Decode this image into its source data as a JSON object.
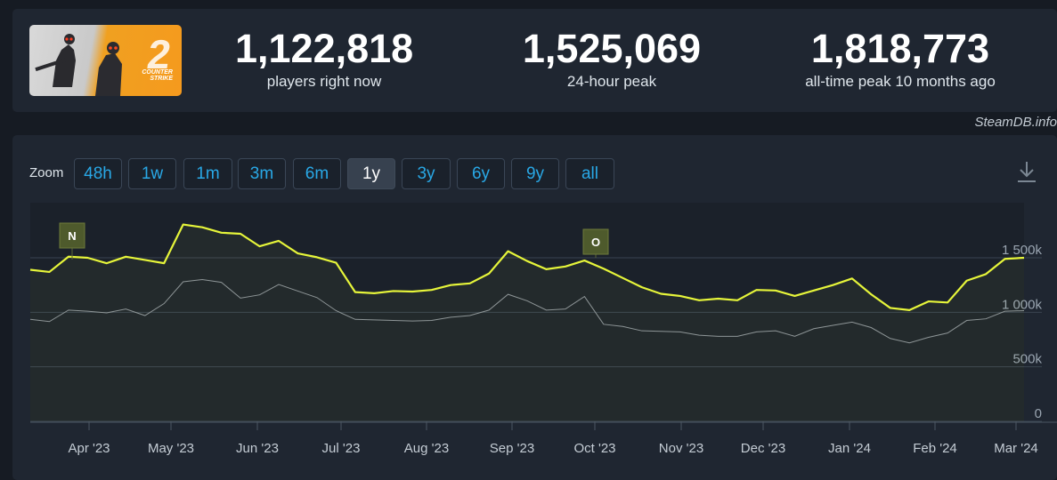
{
  "header": {
    "logo": {
      "icon": "counter-strike-2-logo",
      "text_line1": "COUNTER",
      "text_line2": "STRIKE",
      "num": "2"
    },
    "stats": [
      {
        "value": "1,122,818",
        "label": "players right now"
      },
      {
        "value": "1,525,069",
        "label": "24-hour peak"
      },
      {
        "value": "1,818,773",
        "label": "all-time peak 10 months ago"
      }
    ]
  },
  "watermark": "SteamDB.info",
  "toolbar": {
    "zoom_label": "Zoom",
    "zoom_buttons": [
      "48h",
      "1w",
      "1m",
      "3m",
      "6m",
      "1y",
      "3y",
      "6y",
      "9y",
      "all"
    ],
    "active_zoom": "1y",
    "download_icon": "download-icon"
  },
  "colors": {
    "primary_line": "#e6f53a",
    "secondary_line": "#8d949c",
    "flag_bg": "#4e5a2c",
    "accent_blue": "#29a8e6"
  },
  "chart_data": {
    "type": "line",
    "x": [
      "2023-03-06",
      "2023-03-11",
      "2023-03-13",
      "2023-03-21",
      "2023-03-29",
      "2023-04-06",
      "2023-04-14",
      "2023-04-22",
      "2023-04-30",
      "2023-05-07",
      "2023-05-15",
      "2023-05-22",
      "2023-05-30",
      "2023-06-06",
      "2023-06-14",
      "2023-06-21",
      "2023-06-29",
      "2023-07-06",
      "2023-07-14",
      "2023-07-21",
      "2023-07-29",
      "2023-08-05",
      "2023-08-13",
      "2023-08-20",
      "2023-08-27",
      "2023-09-02",
      "2023-09-10",
      "2023-09-17",
      "2023-09-25",
      "2023-10-02",
      "2023-10-10",
      "2023-10-18",
      "2023-10-26",
      "2023-11-02",
      "2023-11-10",
      "2023-11-18",
      "2023-11-26",
      "2023-12-03",
      "2023-12-11",
      "2023-12-19",
      "2023-12-27",
      "2024-01-03",
      "2024-01-11",
      "2024-01-19",
      "2024-01-27",
      "2024-02-04",
      "2024-02-12",
      "2024-02-19",
      "2024-02-27",
      "2024-03-04"
    ],
    "series": [
      {
        "values": [
          1390,
          1370,
          1510,
          1500,
          1450,
          1510,
          1480,
          1450,
          1805,
          1780,
          1730,
          1720,
          1605,
          1655,
          1540,
          1505,
          1455,
          1185,
          1175,
          1195,
          1190,
          1205,
          1250,
          1265,
          1355,
          1560,
          1470,
          1395,
          1420,
          1475,
          1400,
          1315,
          1230,
          1170,
          1150,
          1110,
          1125,
          1110,
          1205,
          1200,
          1150,
          1200,
          1250,
          1310,
          1165,
          1040,
          1020,
          1100,
          1090,
          1290,
          1350,
          1490,
          1500
        ]
      },
      {
        "values": [
          935,
          915,
          1020,
          1010,
          995,
          1030,
          970,
          1080,
          1280,
          1300,
          1275,
          1130,
          1160,
          1255,
          1195,
          1135,
          1015,
          935,
          930,
          925,
          920,
          925,
          955,
          970,
          1020,
          1165,
          1105,
          1020,
          1030,
          1145,
          890,
          870,
          830,
          825,
          820,
          790,
          780,
          780,
          820,
          830,
          780,
          850,
          880,
          910,
          860,
          760,
          720,
          770,
          810,
          925,
          940,
          1010,
          1015
        ]
      }
    ],
    "xlabels": [
      "Apr '23",
      "May '23",
      "Jun '23",
      "Jul '23",
      "Aug '23",
      "Sep '23",
      "Oct '23",
      "Nov '23",
      "Dec '23",
      "Jan '24",
      "Feb '24",
      "Mar '24"
    ],
    "ylabels": [
      "0",
      "500k",
      "1 000k",
      "1 500k"
    ],
    "ylim": [
      0,
      2000
    ],
    "annotations": [
      {
        "label": "N"
      },
      {
        "label": "O"
      }
    ],
    "grid": true
  }
}
